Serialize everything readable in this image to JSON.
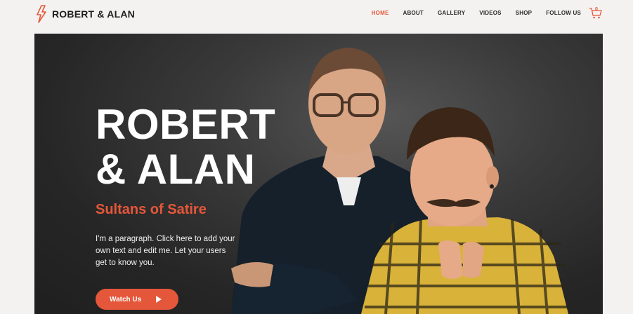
{
  "header": {
    "logo_text": "ROBERT & ALAN",
    "nav": [
      "HOME",
      "ABOUT",
      "GALLERY",
      "VIDEOS",
      "SHOP",
      "FOLLOW US"
    ],
    "active": "HOME",
    "cart_count": "0"
  },
  "hero": {
    "title_line1": "ROBERT",
    "title_line2": "& ALAN",
    "subtitle": "Sultans of Satire",
    "paragraph": "I'm a paragraph. Click here to add your own text and edit me. Let your users get to know you.",
    "button_label": "Watch Us"
  },
  "colors": {
    "accent": "#e5573a",
    "hero_bg": "#2b2b2b"
  }
}
